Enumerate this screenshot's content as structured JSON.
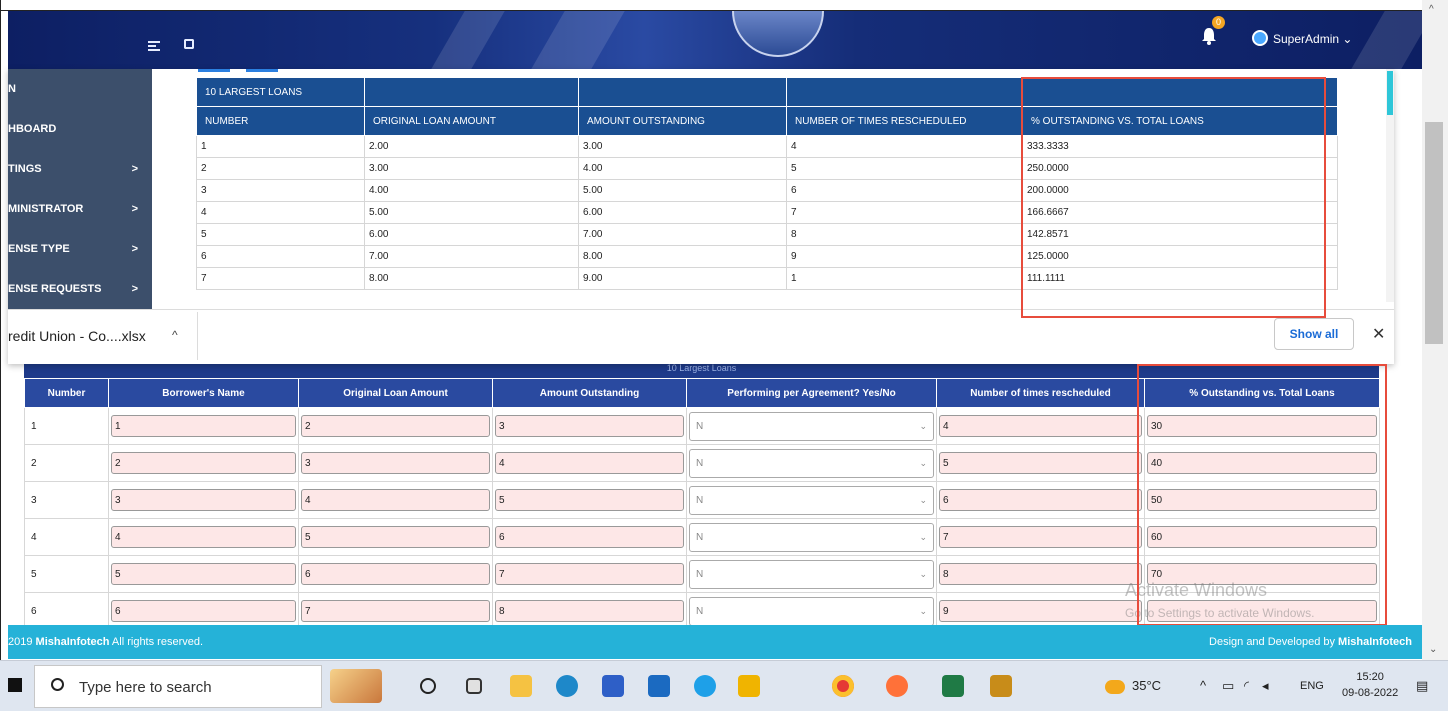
{
  "header": {
    "user_name": "SuperAdmin",
    "notification_count": "0"
  },
  "sidebar": {
    "items": [
      {
        "label": "N",
        "chevron": ""
      },
      {
        "label": "HBOARD",
        "chevron": ""
      },
      {
        "label": "TINGS",
        "chevron": ">"
      },
      {
        "label": "MINISTRATOR",
        "chevron": ">"
      },
      {
        "label": "ENSE TYPE",
        "chevron": ">"
      },
      {
        "label": "ENSE REQUESTS",
        "chevron": ">"
      }
    ]
  },
  "preview_table": {
    "group_header": "10 LARGEST LOANS",
    "columns": [
      "NUMBER",
      "ORIGINAL LOAN AMOUNT",
      "AMOUNT OUTSTANDING",
      "NUMBER OF TIMES RESCHEDULED",
      "% OUTSTANDING VS. TOTAL LOANS"
    ],
    "rows": [
      [
        "1",
        "2.00",
        "3.00",
        "4",
        "333.3333"
      ],
      [
        "2",
        "3.00",
        "4.00",
        "5",
        "250.0000"
      ],
      [
        "3",
        "4.00",
        "5.00",
        "6",
        "200.0000"
      ],
      [
        "4",
        "5.00",
        "6.00",
        "7",
        "166.6667"
      ],
      [
        "5",
        "6.00",
        "7.00",
        "8",
        "142.8571"
      ],
      [
        "6",
        "7.00",
        "8.00",
        "9",
        "125.0000"
      ],
      [
        "7",
        "8.00",
        "9.00",
        "1",
        "111.1111"
      ]
    ]
  },
  "download_bar": {
    "file_name": "redit Union - Co....xlsx",
    "show_all_label": "Show all"
  },
  "form": {
    "title": "10 Largest Loans",
    "columns": [
      "Number",
      "Borrower's Name",
      "Original Loan Amount",
      "Amount Outstanding",
      "Performing per Agreement? Yes/No",
      "Number of times rescheduled",
      "% Outstanding vs. Total Loans"
    ],
    "rows": [
      {
        "number": "1",
        "borrower": "1",
        "original": "2",
        "outstanding": "3",
        "performing": "N",
        "rescheduled": "4",
        "pct": "30"
      },
      {
        "number": "2",
        "borrower": "2",
        "original": "3",
        "outstanding": "4",
        "performing": "N",
        "rescheduled": "5",
        "pct": "40"
      },
      {
        "number": "3",
        "borrower": "3",
        "original": "4",
        "outstanding": "5",
        "performing": "N",
        "rescheduled": "6",
        "pct": "50"
      },
      {
        "number": "4",
        "borrower": "4",
        "original": "5",
        "outstanding": "6",
        "performing": "N",
        "rescheduled": "7",
        "pct": "60"
      },
      {
        "number": "5",
        "borrower": "5",
        "original": "6",
        "outstanding": "7",
        "performing": "N",
        "rescheduled": "8",
        "pct": "70"
      },
      {
        "number": "6",
        "borrower": "6",
        "original": "7",
        "outstanding": "8",
        "performing": "N",
        "rescheduled": "9",
        "pct": ""
      }
    ]
  },
  "watermark": {
    "line1": "Activate Windows",
    "line2": "Go to Settings to activate Windows."
  },
  "footer": {
    "copyright_prefix": "2019 ",
    "copyright_brand": "MishaInfotech",
    "copyright_suffix": " All rights reserved.",
    "credit_prefix": "Design and Developed by ",
    "credit_brand": "MishaInfotech"
  },
  "taskbar": {
    "search_placeholder": "Type here to search",
    "temperature": "35°C",
    "language": "ENG",
    "time": "15:20",
    "date": "09-08-2022"
  },
  "colors": {
    "header": "#0d1f63",
    "table_header": "#1a4f92",
    "footer": "#25b2d8",
    "highlight": "#e74c3c",
    "input_bg": "#fde7e7"
  }
}
